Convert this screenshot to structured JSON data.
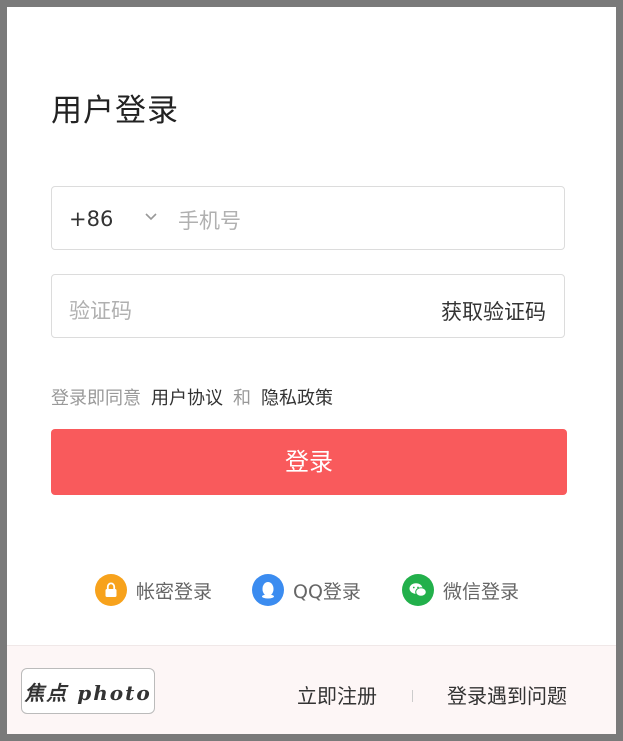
{
  "title": "用户登录",
  "phone_field": {
    "country_code": "+86",
    "placeholder": "手机号"
  },
  "code_field": {
    "placeholder": "验证码",
    "get_code_label": "获取验证码"
  },
  "agreement": {
    "prefix": "登录即同意",
    "terms_link": "用户协议",
    "and": "和",
    "privacy_link": "隐私政策"
  },
  "login_button": "登录",
  "social_logins": [
    {
      "icon": "lock-icon",
      "label": "帐密登录",
      "color": "#f7a21c"
    },
    {
      "icon": "qq-icon",
      "label": "QQ登录",
      "color": "#3b8cf0"
    },
    {
      "icon": "wechat-icon",
      "label": "微信登录",
      "color": "#22b04b"
    }
  ],
  "footer": {
    "watermark": "焦点 photo",
    "register_link": "立即注册",
    "help_link": "登录遇到问题"
  }
}
